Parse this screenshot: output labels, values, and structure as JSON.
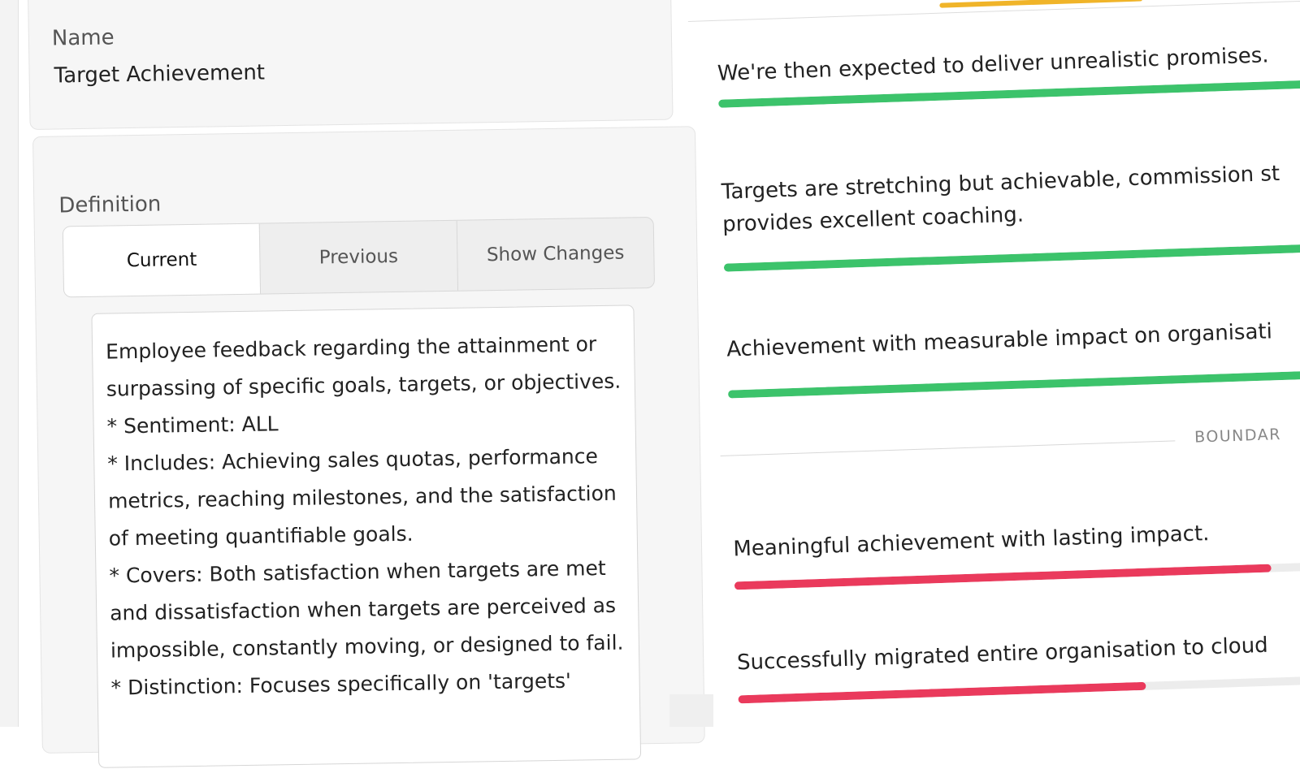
{
  "name_field": {
    "label": "Name",
    "value": "Target Achievement"
  },
  "definition": {
    "label": "Definition",
    "tabs": [
      {
        "label": "Current",
        "active": true
      },
      {
        "label": "Previous",
        "active": false
      },
      {
        "label": "Show Changes",
        "active": false
      }
    ],
    "text": "Employee feedback regarding the attainment or surpassing of specific goals, targets, or objectives.\n* Sentiment: ALL\n* Includes: Achieving sales quotas, performance metrics, reaching milestones, and the satisfaction of meeting quantifiable goals.\n* Covers: Both satisfaction when targets are met and dissatisfaction when targets are perceived as impossible, constantly moving, or designed to fail.\n* Distinction: Focuses specifically on 'targets'"
  },
  "examples": [
    {
      "text": "We're then expected to deliver unrealistic promises.",
      "score": 1.0,
      "color": "#3cc36b"
    },
    {
      "text": "Targets are stretching but achievable, commission st",
      "text_line2": "provides excellent coaching.",
      "score": 1.0,
      "color": "#3cc36b"
    },
    {
      "text": "Achievement with measurable impact on organisati",
      "score": 1.0,
      "color": "#3cc36b"
    }
  ],
  "boundary_label": "BOUNDAR",
  "boundary_examples": [
    {
      "text": "Meaningful achievement with lasting impact.",
      "score": 0.87,
      "color": "#ea3a5c"
    },
    {
      "text": "Successfully migrated entire organisation to cloud",
      "score": 0.66,
      "color": "#ea3a5c"
    }
  ],
  "colors": {
    "accent_top": "#f0b429",
    "positive": "#3cc36b",
    "boundary": "#ea3a5c"
  }
}
